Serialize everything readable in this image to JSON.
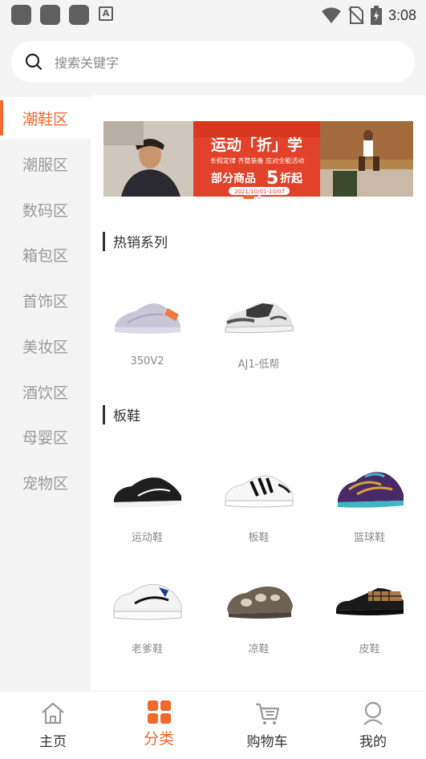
{
  "status_bar": {
    "time": "3:08",
    "notification_badge": "A"
  },
  "search": {
    "placeholder": "搜索关键字"
  },
  "sidebar": {
    "items": [
      {
        "label": "潮鞋区",
        "active": true
      },
      {
        "label": "潮服区",
        "active": false
      },
      {
        "label": "数码区",
        "active": false
      },
      {
        "label": "箱包区",
        "active": false
      },
      {
        "label": "首饰区",
        "active": false
      },
      {
        "label": "美妆区",
        "active": false
      },
      {
        "label": "酒饮区",
        "active": false
      },
      {
        "label": "母婴区",
        "active": false
      },
      {
        "label": "宠物区",
        "active": false
      }
    ]
  },
  "banner": {
    "headline": "运动「折」学",
    "subline": "长假定律 齐整装备 应对全能活动",
    "offer_prefix": "部分商品",
    "offer_number": "5",
    "offer_suffix": "折起",
    "date_range": "2021/10/01-10/07"
  },
  "sections": [
    {
      "title": "热销系列",
      "products": [
        {
          "label": "350V2",
          "icon": "sneaker-yeezy-image"
        },
        {
          "label": "AJ1-低帮",
          "icon": "sneaker-aj1-image"
        }
      ]
    },
    {
      "title": "板鞋",
      "products": [
        {
          "label": "运动鞋",
          "icon": "running-shoe-image"
        },
        {
          "label": "板鞋",
          "icon": "skate-shoe-image"
        },
        {
          "label": "篮球鞋",
          "icon": "basketball-shoe-image"
        },
        {
          "label": "老爹鞋",
          "icon": "dad-shoe-image"
        },
        {
          "label": "凉鞋",
          "icon": "sandal-image"
        },
        {
          "label": "皮鞋",
          "icon": "leather-shoe-image"
        }
      ]
    }
  ],
  "tabbar": {
    "items": [
      {
        "label": "主页",
        "icon": "home-icon",
        "active": false
      },
      {
        "label": "分类",
        "icon": "category-icon",
        "active": true
      },
      {
        "label": "购物车",
        "icon": "cart-icon",
        "active": false
      },
      {
        "label": "我的",
        "icon": "profile-icon",
        "active": false
      }
    ]
  },
  "colors": {
    "accent": "#f06a2f",
    "sidebar_bg": "#f4f4f4",
    "text_muted": "#8a8a8a"
  }
}
